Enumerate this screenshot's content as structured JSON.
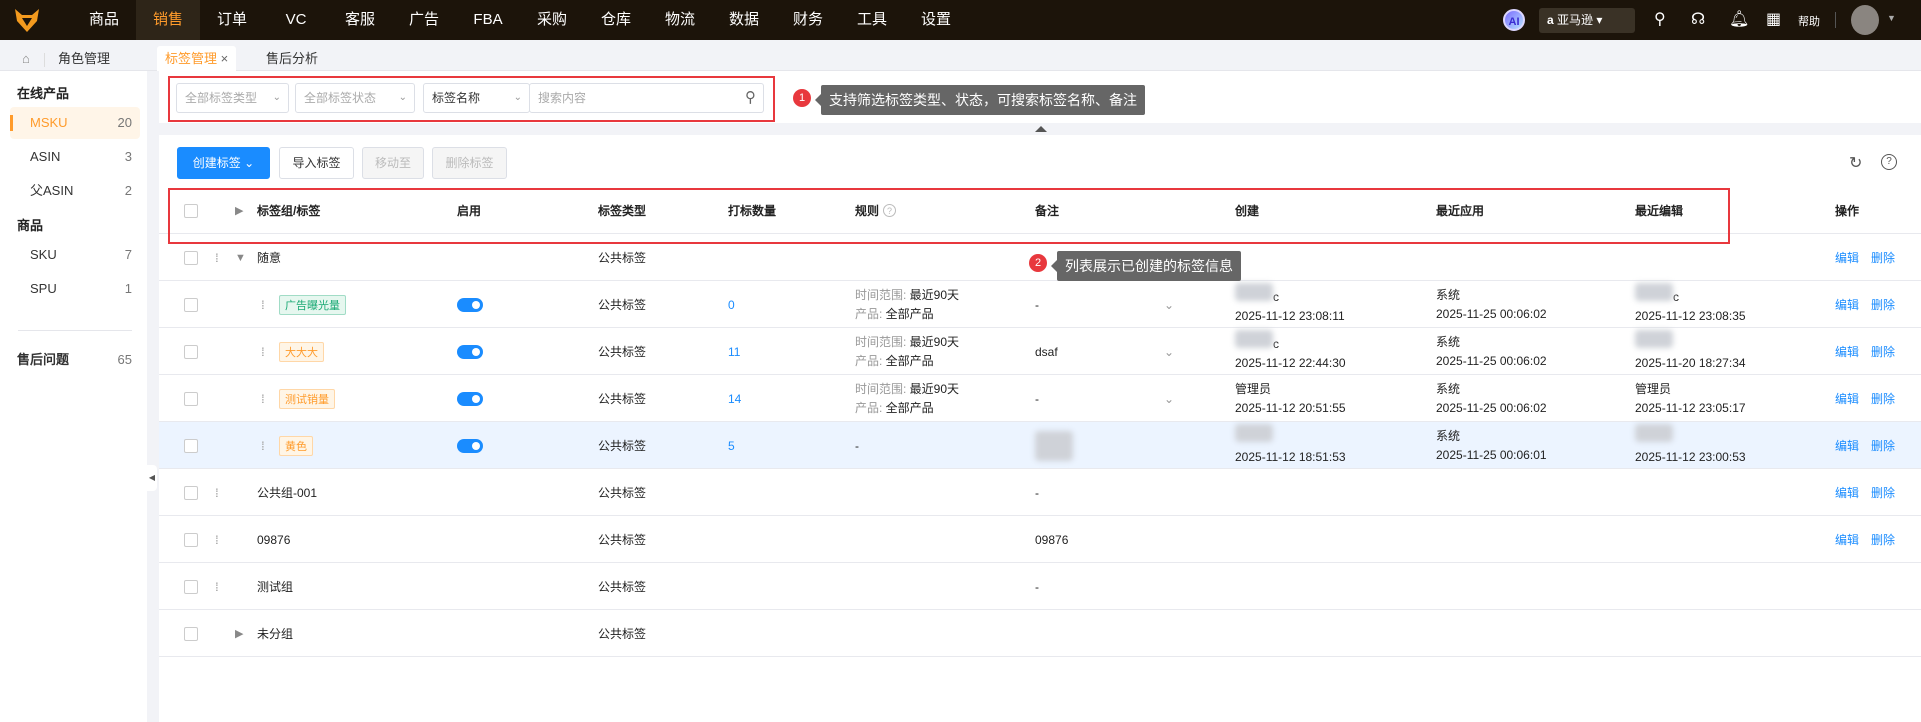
{
  "nav": {
    "items": [
      "商品",
      "销售",
      "订单",
      "VC",
      "客服",
      "广告",
      "FBA",
      "采购",
      "仓库",
      "物流",
      "数据",
      "财务",
      "工具",
      "设置"
    ],
    "active": 1,
    "ai_label": "AI",
    "store_label": "亚马逊",
    "help_label": "帮助"
  },
  "tabs": {
    "home_label": "角色管理",
    "items": [
      "标签管理",
      "售后分析"
    ],
    "close": "×"
  },
  "sidebar": {
    "groups": [
      {
        "title": "在线产品",
        "items": [
          {
            "label": "MSKU",
            "count": "20",
            "active": true
          },
          {
            "label": "ASIN",
            "count": "3"
          },
          {
            "label": "父ASIN",
            "count": "2"
          }
        ]
      },
      {
        "title": "商品",
        "items": [
          {
            "label": "SKU",
            "count": "7"
          },
          {
            "label": "SPU",
            "count": "1"
          }
        ]
      }
    ],
    "after_sales": {
      "label": "售后问题",
      "count": "65"
    }
  },
  "filter": {
    "type_placeholder": "全部标签类型",
    "status_placeholder": "全部标签状态",
    "field_select": "标签名称",
    "search_placeholder": "搜索内容"
  },
  "annotations": [
    {
      "num": "1",
      "text": "支持筛选标签类型、状态，可搜索标签名称、备注"
    },
    {
      "num": "2",
      "text": "列表展示已创建的标签信息"
    }
  ],
  "toolbar": {
    "create": "创建标签",
    "import": "导入标签",
    "move": "移动至",
    "delete": "删除标签"
  },
  "table": {
    "headers": [
      "标签组/标签",
      "启用",
      "标签类型",
      "打标数量",
      "规则",
      "备注",
      "创建",
      "最近应用",
      "最近编辑",
      "操作"
    ],
    "edit": "编辑",
    "remove": "删除",
    "rows": [
      {
        "kind": "group",
        "name": "随意",
        "expanded": true,
        "type": "公共标签",
        "drag": true
      },
      {
        "kind": "tag",
        "name": "广告曝光量",
        "tag_color": "#19a974",
        "tag_bg": "#e6f7ef",
        "enabled": true,
        "type": "公共标签",
        "count": "0",
        "rule": [
          "时间范围: ",
          "最近90天",
          "产品: ",
          "全部产品"
        ],
        "note": "-",
        "created_by": "c",
        "created": "2025-11-12 23:08:11",
        "applied_by": "系统",
        "applied": "2025-11-25 00:06:02",
        "edited_by": "c",
        "edited": "2025-11-12 23:08:35"
      },
      {
        "kind": "tag",
        "name": "大大大",
        "tag_color": "#ff9b2b",
        "tag_bg": "#fff5e6",
        "enabled": true,
        "type": "公共标签",
        "count": "11",
        "rule": [
          "时间范围: ",
          "最近90天",
          "产品: ",
          "全部产品"
        ],
        "note": "dsaf",
        "created_by": "c",
        "created": "2025-11-12 22:44:30",
        "applied_by": "系统",
        "applied": "2025-11-25 00:06:02",
        "edited_by": "",
        "edited": "2025-11-20 18:27:34"
      },
      {
        "kind": "tag",
        "name": "测试销量",
        "tag_color": "#ff9b2b",
        "tag_bg": "#fff5e6",
        "enabled": true,
        "type": "公共标签",
        "count": "14",
        "rule": [
          "时间范围: ",
          "最近90天",
          "产品: ",
          "全部产品"
        ],
        "note": "-",
        "created_by": "管理员",
        "created": "2025-11-12 20:51:55",
        "applied_by": "系统",
        "applied": "2025-11-25 00:06:02",
        "edited_by": "管理员",
        "edited": "2025-11-12 23:05:17"
      },
      {
        "kind": "tag",
        "name": "黄色",
        "tag_color": "#ff9b2b",
        "tag_bg": "#fff5e6",
        "enabled": true,
        "type": "公共标签",
        "count": "5",
        "rule_none": "-",
        "note_blur": true,
        "created_by": "",
        "created": "2025-11-12 18:51:53",
        "applied_by": "系统",
        "applied": "2025-11-25 00:06:01",
        "edited_by": "",
        "edited": "2025-11-12 23:00:53",
        "highlight": true
      },
      {
        "kind": "group",
        "name": "公共组-001",
        "type": "公共标签",
        "drag": true,
        "note": "-"
      },
      {
        "kind": "group",
        "name": "09876",
        "type": "公共标签",
        "drag": true,
        "note": "09876"
      },
      {
        "kind": "group",
        "name": "测试组",
        "type": "公共标签",
        "drag": true,
        "note": "-"
      },
      {
        "kind": "group",
        "name": "未分组",
        "collapsed": true,
        "type": "公共标签",
        "no_ops": true
      }
    ]
  },
  "colors": {
    "accent": "#ff9b2b",
    "primary": "#1a8cff",
    "annotation": "#e8383d",
    "topbar": "#1c140a"
  }
}
